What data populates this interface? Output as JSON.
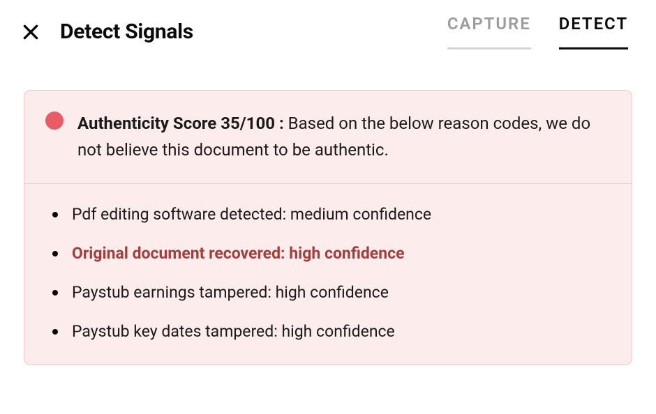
{
  "header": {
    "title": "Detect Signals",
    "tabs": {
      "capture": "CAPTURE",
      "detect": "DETECT"
    }
  },
  "panel": {
    "dot_color": "#e85c68",
    "score_label": "Authenticity Score 35/100 :",
    "score_text": "Based on the below reason codes, we do not believe this document to be authentic.",
    "reasons": [
      {
        "text": "Pdf editing software detected: medium confidence",
        "highlight": false
      },
      {
        "text": "Original document recovered: high confidence",
        "highlight": true
      },
      {
        "text": "Paystub earnings tampered: high confidence",
        "highlight": false
      },
      {
        "text": "Paystub key dates tampered: high confidence",
        "highlight": false
      }
    ]
  }
}
